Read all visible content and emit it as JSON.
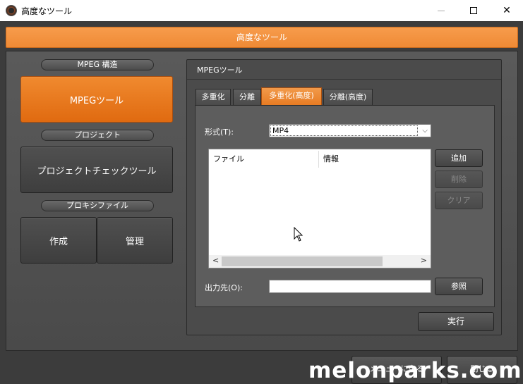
{
  "window": {
    "title": "高度なツール"
  },
  "header": {
    "title": "高度なツール"
  },
  "left": {
    "mpeg_section": "MPEG 構造",
    "mpeg_tool_button": "MPEGツール",
    "project_section": "プロジェクト",
    "project_check_button": "プロジェクトチェックツール",
    "proxy_section": "プロキシファイル",
    "create_button": "作成",
    "manage_button": "管理"
  },
  "panel": {
    "title": "MPEGツール",
    "tabs": [
      {
        "label": "多重化",
        "active": false
      },
      {
        "label": "分離",
        "active": false
      },
      {
        "label": "多重化(高度)",
        "active": true
      },
      {
        "label": "分離(高度)",
        "active": false
      }
    ],
    "format_label": "形式(T):",
    "format_value": "MP4",
    "list_columns": [
      "ファイル",
      "情報"
    ],
    "add_button": "追加",
    "delete_button": "削除",
    "clear_button": "クリア",
    "output_label": "出力先(O):",
    "output_value": "",
    "browse_button": "参照",
    "execute_button": "実行"
  },
  "footer": {
    "back_button": "メニューに戻る",
    "close_button": "閉じる"
  },
  "watermark": "melonparks.com",
  "colors": {
    "accent": "#ef8a35",
    "panel_bg": "#4b4b4b"
  }
}
